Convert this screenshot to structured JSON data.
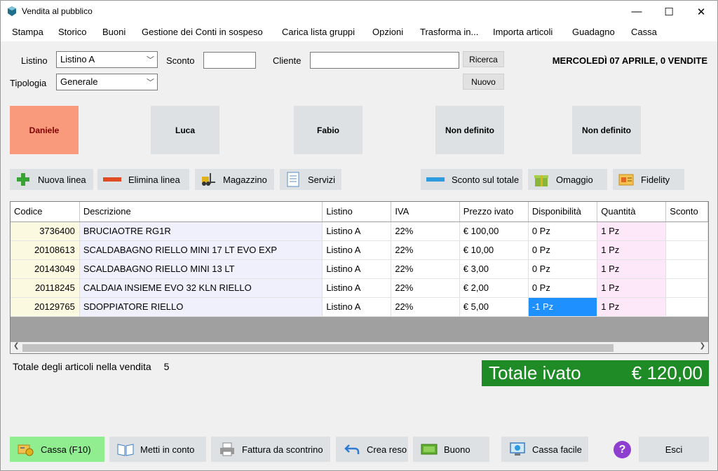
{
  "window": {
    "title": "Vendita al pubblico",
    "minimize": "—",
    "maximize": "☐",
    "close": "✕"
  },
  "menu": [
    "Stampa",
    "Storico",
    "Buoni",
    "Gestione dei Conti in sospeso",
    "Carica lista gruppi",
    "Opzioni",
    "Trasforma in...",
    "Importa articoli",
    "Guadagno",
    "Cassa"
  ],
  "form": {
    "listino_label": "Listino",
    "listino_value": "Listino A",
    "tipologia_label": "Tipologia",
    "tipologia_value": "Generale",
    "sconto_label": "Sconto",
    "sconto_value": "",
    "cliente_label": "Cliente",
    "cliente_value": "",
    "ricerca_label": "Ricerca",
    "nuovo_label": "Nuovo",
    "date_status": "MERCOLEDÌ 07 APRILE, 0 VENDITE"
  },
  "operators": [
    "Daniele",
    "Luca",
    "Fabio",
    "Non definito",
    "Non definito"
  ],
  "toolbar": {
    "nuova_linea": "Nuova linea",
    "elimina_linea": "Elimina linea",
    "magazzino": "Magazzino",
    "servizi": "Servizi",
    "sconto_totale": "Sconto sul totale",
    "omaggio": "Omaggio",
    "fidelity": "Fidelity"
  },
  "table": {
    "columns": [
      "Codice",
      "Descrizione",
      "Listino",
      "IVA",
      "Prezzo ivato",
      "Disponibilità",
      "Quantità",
      "Sconto"
    ],
    "rows": [
      [
        "3736400",
        "BRUCIAOTRE RG1R",
        "Listino A",
        "22%",
        "€ 100,00",
        "0 Pz",
        "1 Pz",
        ""
      ],
      [
        "20108613",
        "SCALDABAGNO RIELLO MINI 17 LT EVO EXP",
        "Listino A",
        "22%",
        "€ 10,00",
        "0 Pz",
        "1 Pz",
        ""
      ],
      [
        "20143049",
        "SCALDABAGNO RIELLO MINI 13 LT",
        "Listino A",
        "22%",
        "€ 3,00",
        "0 Pz",
        "1 Pz",
        ""
      ],
      [
        "20118245",
        "CALDAIA INSIEME EVO 32 KLN RIELLO",
        "Listino A",
        "22%",
        "€ 2,00",
        "0 Pz",
        "1 Pz",
        ""
      ],
      [
        "20129765",
        "SDOPPIATORE RIELLO",
        "Listino A",
        "22%",
        "€ 5,00",
        "-1 Pz",
        "1 Pz",
        ""
      ]
    ]
  },
  "totals": {
    "articles_label": "Totale degli articoli nella vendita",
    "articles_count": "5",
    "total_label": "Totale ivato",
    "total_value": "€ 120,00"
  },
  "bottom": {
    "cassa": "Cassa (F10)",
    "metti_conto": "Metti in conto",
    "fattura": "Fattura da scontrino",
    "crea_reso": "Crea reso",
    "buono": "Buono",
    "cassa_facile": "Cassa facile",
    "help": "?",
    "esci": "Esci"
  },
  "colors": {
    "total_bg": "#1f8b26",
    "active_operator": "#fa9a7c",
    "cassa_btn": "#90ee90",
    "selected_cell": "#1e90ff"
  }
}
